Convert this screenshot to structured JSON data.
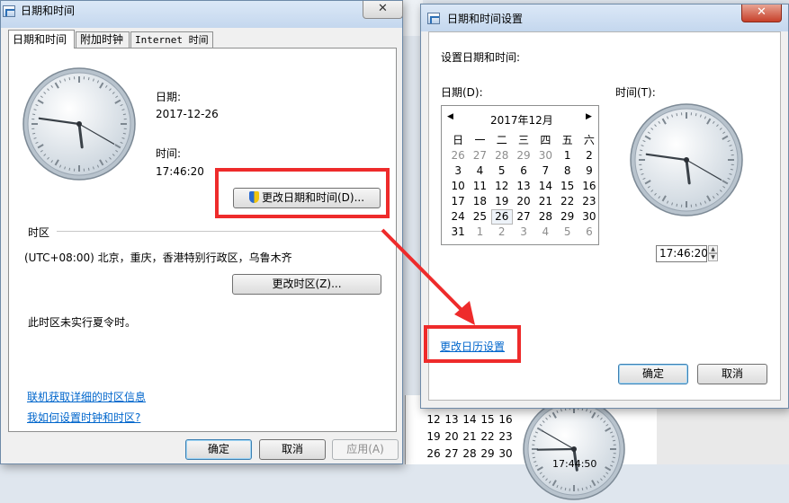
{
  "main_window": {
    "title": "日期和时间",
    "tabs": [
      "日期和时间",
      "附加时钟",
      "Internet 时间"
    ],
    "date_label": "日期:",
    "date_value": "2017-12-26",
    "time_label": "时间:",
    "time_value": "17:46:20",
    "change_datetime_button": "更改日期和时间(D)...",
    "timezone_heading": "时区",
    "timezone_value": "(UTC+08:00) 北京，重庆，香港特别行政区，乌鲁木齐",
    "change_timezone_button": "更改时区(Z)...",
    "dst_note": "此时区未实行夏令时。",
    "link_online_tz": "联机获取详细的时区信息",
    "link_how_set": "我如何设置时钟和时区?",
    "ok_button": "确定",
    "cancel_button": "取消",
    "apply_button": "应用(A)"
  },
  "settings_window": {
    "title": "日期和时间设置",
    "heading": "设置日期和时间:",
    "date_label": "日期(D):",
    "time_label": "时间(T):",
    "calendar_month": "2017年12月",
    "weekdays": [
      "日",
      "一",
      "二",
      "三",
      "四",
      "五",
      "六"
    ],
    "weeks": [
      [
        "26",
        "27",
        "28",
        "29",
        "30",
        "1",
        "2"
      ],
      [
        "3",
        "4",
        "5",
        "6",
        "7",
        "8",
        "9"
      ],
      [
        "10",
        "11",
        "12",
        "13",
        "14",
        "15",
        "16"
      ],
      [
        "17",
        "18",
        "19",
        "20",
        "21",
        "22",
        "23"
      ],
      [
        "24",
        "25",
        "26",
        "27",
        "28",
        "29",
        "30"
      ],
      [
        "31",
        "1",
        "2",
        "3",
        "4",
        "5",
        "6"
      ]
    ],
    "selected_day": "26",
    "time_value": "17:46:20",
    "change_calendar_link": "更改日历设置",
    "ok_button": "确定",
    "cancel_button": "取消"
  },
  "background": {
    "calendar_rows": [
      [
        "12",
        "13",
        "14",
        "15",
        "16"
      ],
      [
        "19",
        "20",
        "21",
        "22",
        "23"
      ],
      [
        "26",
        "27",
        "28",
        "29",
        "30"
      ]
    ],
    "clock_time": "17:44:50"
  },
  "clocks": {
    "main": {
      "hour": 17,
      "minute": 46,
      "second": 20
    },
    "settings": {
      "hour": 17,
      "minute": 46,
      "second": 20
    },
    "background": {
      "hour": 17,
      "minute": 44,
      "second": 50
    }
  },
  "colors": {
    "highlight_box": "#ee2b2b",
    "link": "#0066cc",
    "titlebar": "#c4d7ee"
  }
}
